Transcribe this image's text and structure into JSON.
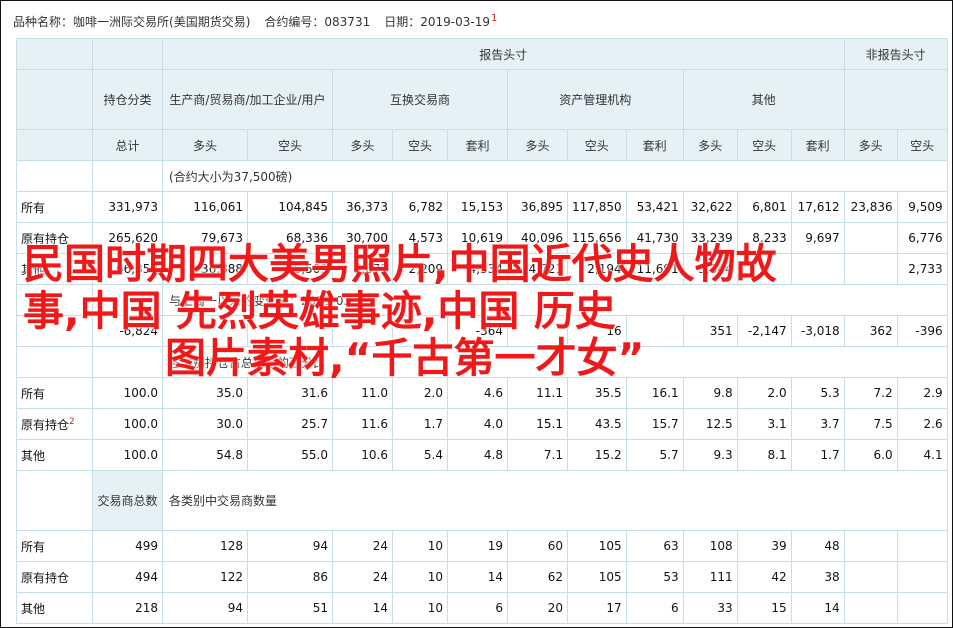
{
  "header": {
    "name_label": "品种名称：",
    "name_value": "咖啡一洲际交易所(美国期货交易)",
    "code_label": "合约编号：",
    "code_value": "083731",
    "date_label": "日期：",
    "date_value": "2019-03-19",
    "footnote": "1"
  },
  "table": {
    "h_reportable": "报告头寸",
    "h_nonreportable": "非报告头寸",
    "h_position_class": "持仓分类",
    "h_producer": "生产商/贸易商/加工企业/用户",
    "h_swap": "互换交易商",
    "h_managed": "资产管理机构",
    "h_other": "其他",
    "sub_total": "总计",
    "sub_long": "多头",
    "sub_short": "空头",
    "sub_spread": "套利",
    "unit_note": "(合约大小为37,500磅)",
    "change_note": "与上周一以来的变化量：2019-03-12",
    "pct_note": "各类别持仓占总持仓的百分比",
    "traders_head": "交易商总数",
    "traders_note": "各类别中交易商数量",
    "rows_abs": [
      {
        "label": "所有",
        "v": [
          "331,973",
          "116,061",
          "104,845",
          "36,373",
          "6,782",
          "15,153",
          "36,895",
          "117,850",
          "53,421",
          "32,622",
          "6,801",
          "17,612",
          "23,836",
          "9,509"
        ]
      },
      {
        "label": "原有持仓",
        "v": [
          "265,620",
          "79,673",
          "68,336",
          "30,700",
          "4,573",
          "10,619",
          "40,096",
          "115,656",
          "41,730",
          "33,239",
          "8,233",
          "9,697",
          "",
          "6,776"
        ]
      },
      {
        "label": "其他",
        "v": [
          "66,353",
          "36,388",
          "36,509",
          "5,673",
          "2,209",
          "4,534",
          "4,721",
          "2,194",
          "11,691",
          "5,344",
          "",
          "",
          "",
          "2,733"
        ]
      }
    ],
    "row_change": {
      "label": "",
      "v": [
        "-6,824",
        "",
        "",
        "",
        "",
        "-364",
        "",
        "16",
        "",
        "351",
        "-2,147",
        "-3,018",
        "362",
        "-396"
      ]
    },
    "rows_pct": [
      {
        "label": "所有",
        "v": [
          "100.0",
          "35.0",
          "31.6",
          "11.0",
          "2.0",
          "4.6",
          "11.1",
          "35.5",
          "16.1",
          "9.8",
          "2.0",
          "5.3",
          "7.2",
          "2.9"
        ]
      },
      {
        "label": "原有持仓",
        "sup": "2",
        "v": [
          "100.0",
          "30.0",
          "25.7",
          "11.6",
          "1.7",
          "4.0",
          "15.1",
          "43.5",
          "15.7",
          "12.5",
          "3.1",
          "3.7",
          "7.5",
          "2.6"
        ]
      },
      {
        "label": "其他",
        "v": [
          "100.0",
          "54.8",
          "55.0",
          "10.6",
          "5.4",
          "4.8",
          "7.1",
          "15.2",
          "5.7",
          "9.3",
          "8.1",
          "1.7",
          "6.0",
          "4.1"
        ]
      }
    ],
    "rows_traders": [
      {
        "label": "所有",
        "v": [
          "499",
          "128",
          "94",
          "24",
          "10",
          "19",
          "60",
          "105",
          "63",
          "108",
          "39",
          "48",
          "",
          ""
        ]
      },
      {
        "label": "原有持仓",
        "v": [
          "494",
          "122",
          "86",
          "24",
          "10",
          "14",
          "62",
          "105",
          "53",
          "111",
          "42",
          "38",
          "",
          ""
        ]
      },
      {
        "label": "其他",
        "v": [
          "218",
          "94",
          "51",
          "14",
          "10",
          "6",
          "20",
          "17",
          "6",
          "33",
          "15",
          "14",
          "",
          ""
        ]
      }
    ]
  },
  "overlay": {
    "line1": "民国时期四大美男照片,中国近代史人物故",
    "line2": "事,中国 先烈英雄事迹,中国 历史",
    "line3": "图片素材,“千古第一才女”"
  }
}
